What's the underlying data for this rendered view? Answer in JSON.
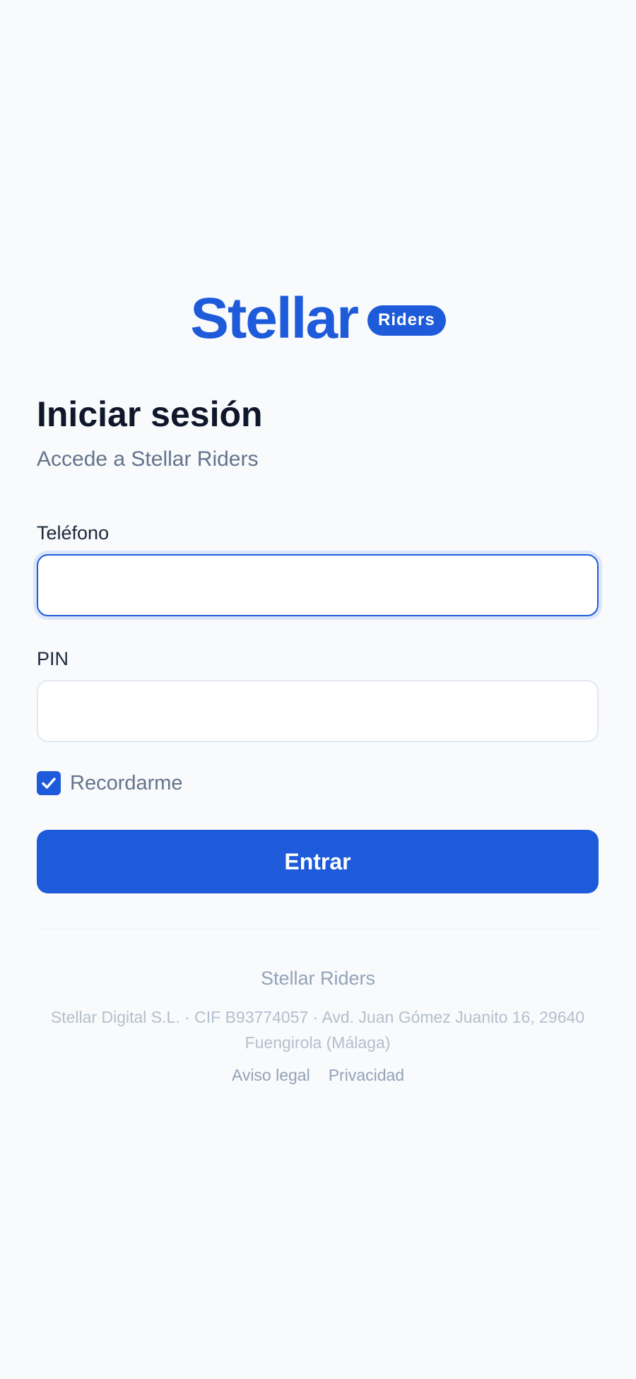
{
  "brand": {
    "name": "Stellar",
    "badge": "Riders"
  },
  "login": {
    "title": "Iniciar sesión",
    "subtitle": "Accede a Stellar Riders",
    "phone": {
      "label": "Teléfono",
      "value": "",
      "placeholder": ""
    },
    "pin": {
      "label": "PIN",
      "value": "",
      "placeholder": ""
    },
    "remember": {
      "label": "Recordarme",
      "checked": true
    },
    "submit_label": "Entrar"
  },
  "footer": {
    "brand": "Stellar Riders",
    "legal": "Stellar Digital S.L. · CIF B93774057 · Avd. Juan Gómez Juanito 16, 29640 Fuengirola (Málaga)",
    "links": [
      "Aviso legal",
      "Privacidad"
    ]
  },
  "colors": {
    "accent": "#1d5bdb",
    "background": "#f8fafc",
    "heading": "#0f172a",
    "muted": "#64748b"
  },
  "icons": {
    "checkbox": "check-icon"
  }
}
